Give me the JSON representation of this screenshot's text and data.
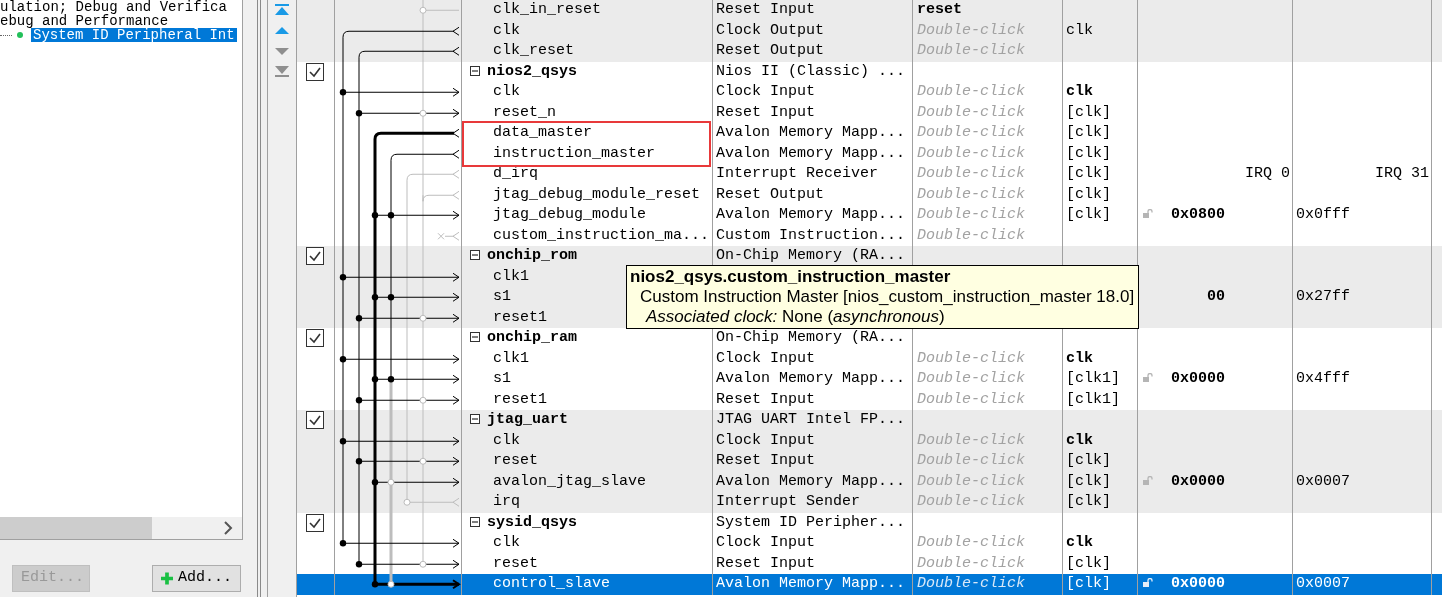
{
  "tree": {
    "lines": [
      {
        "text": "ulation; Debug and Verifica",
        "kind": "category",
        "selected": false
      },
      {
        "text": "ebug and Performance",
        "kind": "category",
        "selected": false
      },
      {
        "text": "System ID Peripheral Int",
        "kind": "leaf",
        "selected": true
      }
    ]
  },
  "tree_buttons": [
    {
      "label": "Edit...",
      "kind": "edit",
      "disabled": true
    },
    {
      "label": "Add...",
      "kind": "add",
      "disabled": false
    }
  ],
  "reorder_buttons": [
    {
      "kind": "top",
      "disabled": false
    },
    {
      "kind": "up",
      "disabled": false
    },
    {
      "kind": "down",
      "disabled": true
    },
    {
      "kind": "bottom",
      "disabled": true
    }
  ],
  "modules": [
    {
      "interfaces": [
        {
          "name": "clk_in_reset",
          "description": "Reset Input",
          "export": "reset",
          "export_emphasized": true,
          "highlighted": false,
          "selected": false
        },
        {
          "name": "clk",
          "description": "Clock Output",
          "export_placeholder": "Double-click",
          "clock": "clk",
          "clock_emphasized": false,
          "highlighted": false,
          "selected": false
        },
        {
          "name": "clk_reset",
          "description": "Reset Output",
          "export_placeholder": "Double-click",
          "highlighted": false,
          "selected": false
        }
      ]
    },
    {
      "name": "nios2_qsys",
      "description": "Nios II (Classic) ...",
      "checked": true,
      "expanded": true,
      "interfaces": [
        {
          "name": "clk",
          "description": "Clock Input",
          "export_placeholder": "Double-click",
          "clock": "clk",
          "clock_emphasized": true,
          "highlighted": false,
          "selected": false
        },
        {
          "name": "reset_n",
          "description": "Reset Input",
          "export_placeholder": "Double-click",
          "clock": "[clk]",
          "clock_emphasized": false,
          "highlighted": false,
          "selected": false
        },
        {
          "name": "data_master",
          "description": "Avalon Memory Mapp...",
          "export_placeholder": "Double-click",
          "clock": "[clk]",
          "clock_emphasized": false,
          "highlighted": true,
          "selected": false
        },
        {
          "name": "instruction_master",
          "description": "Avalon Memory Mapp...",
          "export_placeholder": "Double-click",
          "clock": "[clk]",
          "clock_emphasized": false,
          "highlighted": true,
          "selected": false
        },
        {
          "name": "d_irq",
          "description": "Interrupt Receiver",
          "export_placeholder": "Double-click",
          "clock": "[clk]",
          "clock_emphasized": false,
          "irq_first": "IRQ 0",
          "irq_last": "IRQ 31",
          "highlighted": false,
          "selected": false
        },
        {
          "name": "jtag_debug_module_reset",
          "description": "Reset Output",
          "export_placeholder": "Double-click",
          "clock": "[clk]",
          "clock_emphasized": false,
          "highlighted": false,
          "selected": false
        },
        {
          "name": "jtag_debug_module",
          "description": "Avalon Memory Mapp...",
          "export_placeholder": "Double-click",
          "clock": "[clk]",
          "clock_emphasized": false,
          "base": "0x0800",
          "base_locked": false,
          "end": "0x0fff",
          "highlighted": false,
          "selected": false
        },
        {
          "name": "custom_instruction_ma...",
          "description": "Custom Instruction...",
          "export_placeholder": "Double-click",
          "highlighted": false,
          "selected": false
        }
      ]
    },
    {
      "name": "onchip_rom",
      "description": "On-Chip Memory (RA...",
      "checked": true,
      "expanded": true,
      "interfaces": [
        {
          "name": "clk1",
          "highlighted": false,
          "selected": false
        },
        {
          "name": "s1",
          "base": "00",
          "end": "0x27ff",
          "highlighted": false,
          "selected": false
        },
        {
          "name": "reset1",
          "highlighted": false,
          "selected": false
        }
      ]
    },
    {
      "name": "onchip_ram",
      "description": "On-Chip Memory (RA...",
      "checked": true,
      "expanded": true,
      "interfaces": [
        {
          "name": "clk1",
          "description": "Clock Input",
          "export_placeholder": "Double-click",
          "clock": "clk",
          "clock_emphasized": true,
          "highlighted": false,
          "selected": false
        },
        {
          "name": "s1",
          "description": "Avalon Memory Mapp...",
          "export_placeholder": "Double-click",
          "clock": "[clk1]",
          "clock_emphasized": false,
          "base": "0x0000",
          "base_locked": false,
          "end": "0x4fff",
          "highlighted": false,
          "selected": false
        },
        {
          "name": "reset1",
          "description": "Reset Input",
          "export_placeholder": "Double-click",
          "clock": "[clk1]",
          "clock_emphasized": false,
          "highlighted": false,
          "selected": false
        }
      ]
    },
    {
      "name": "jtag_uart",
      "description": "JTAG UART Intel FP...",
      "checked": true,
      "expanded": true,
      "interfaces": [
        {
          "name": "clk",
          "description": "Clock Input",
          "export_placeholder": "Double-click",
          "clock": "clk",
          "clock_emphasized": true,
          "highlighted": false,
          "selected": false
        },
        {
          "name": "reset",
          "description": "Reset Input",
          "export_placeholder": "Double-click",
          "clock": "[clk]",
          "clock_emphasized": false,
          "highlighted": false,
          "selected": false
        },
        {
          "name": "avalon_jtag_slave",
          "description": "Avalon Memory Mapp...",
          "export_placeholder": "Double-click",
          "clock": "[clk]",
          "clock_emphasized": false,
          "base": "0x0000",
          "base_locked": false,
          "end": "0x0007",
          "highlighted": false,
          "selected": false
        },
        {
          "name": "irq",
          "description": "Interrupt Sender",
          "export_placeholder": "Double-click",
          "clock": "[clk]",
          "clock_emphasized": false,
          "highlighted": false,
          "selected": false
        }
      ]
    },
    {
      "name": "sysid_qsys",
      "description": "System ID Peripher...",
      "checked": true,
      "expanded": true,
      "interfaces": [
        {
          "name": "clk",
          "description": "Clock Input",
          "export_placeholder": "Double-click",
          "clock": "clk",
          "clock_emphasized": true,
          "highlighted": false,
          "selected": false
        },
        {
          "name": "reset",
          "description": "Reset Input",
          "export_placeholder": "Double-click",
          "clock": "[clk]",
          "clock_emphasized": false,
          "highlighted": false,
          "selected": false
        },
        {
          "name": "control_slave",
          "description": "Avalon Memory Mapp...",
          "export_placeholder": "Double-click",
          "clock": "[clk]",
          "clock_emphasized": false,
          "base": "0x0000",
          "base_locked": false,
          "end": "0x0007",
          "highlighted": false,
          "selected": true
        }
      ]
    }
  ],
  "tooltip": {
    "title": "nios2_qsys.custom_instruction_master",
    "lines": [
      "Custom Instruction Master [nios_custom_instruction_master 18.0]",
      "*Associated clock:* None (*asynchronous*)"
    ]
  }
}
